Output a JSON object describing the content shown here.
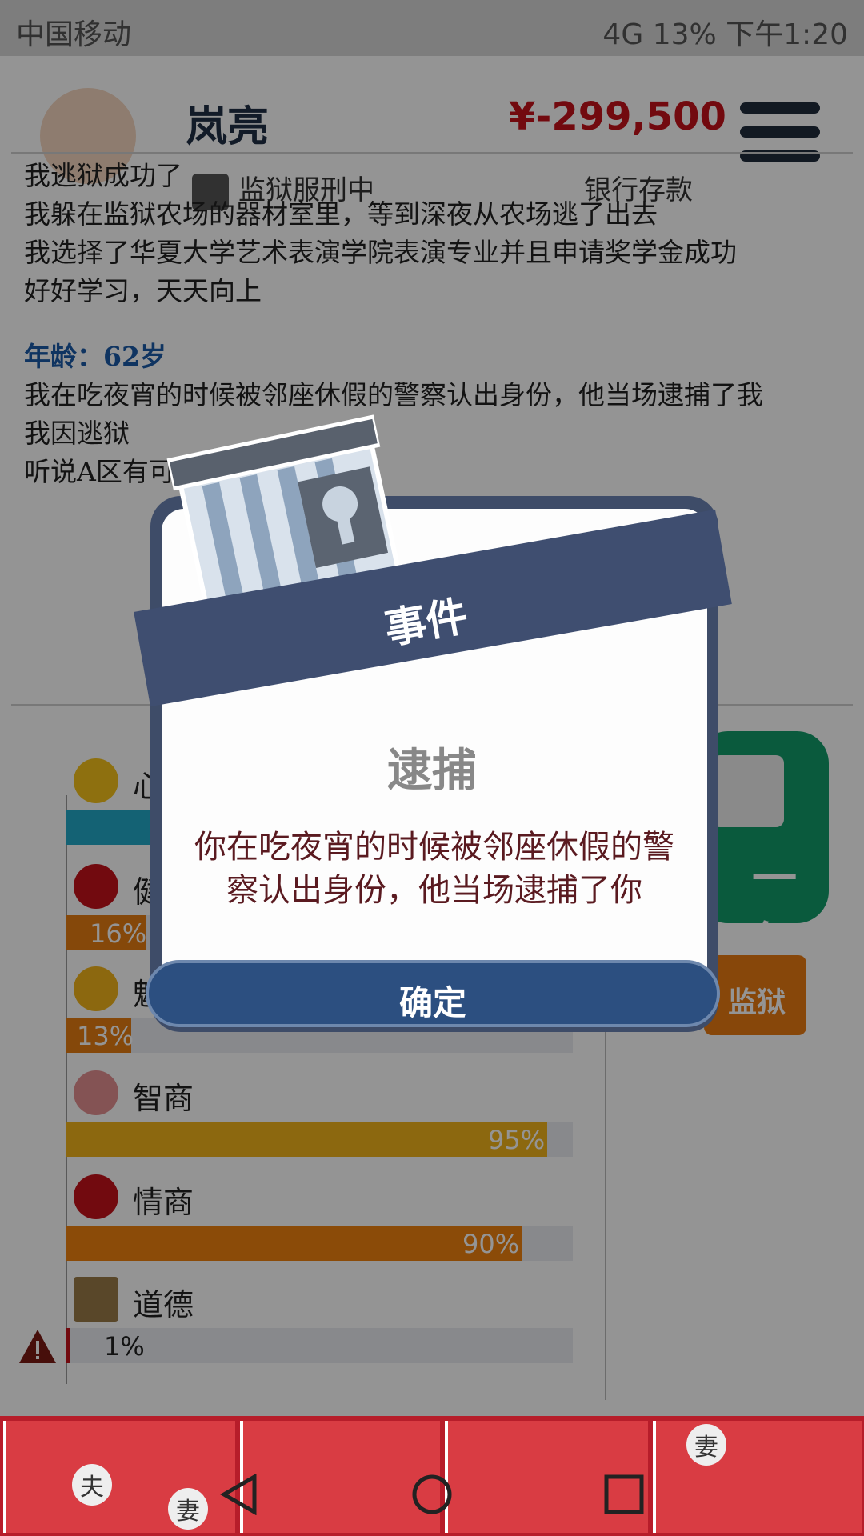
{
  "status_bar": {
    "carrier": "中国移动",
    "network": "4G",
    "battery": "13%",
    "time": "下午1:20"
  },
  "header": {
    "name": "岚亮",
    "money": "¥-299,500",
    "prison_status": "监狱服刑中",
    "bank_label": "银行存款"
  },
  "log": {
    "lines": [
      "我逃狱成功了",
      "我躲在监狱农场的器材室里，等到深夜从农场逃了出去",
      "我选择了华夏大学艺术表演学院表演专业并且申请奖学金成功",
      "好好学习，天天向上"
    ],
    "age": "年龄：62岁",
    "lines2": [
      "我在吃夜宵的时候被邻座休假的警察认出身份，他当场逮捕了我",
      "我因逃狱",
      "听说A区有可以去找他"
    ]
  },
  "stats": [
    {
      "label": "心情",
      "value": 100,
      "text": "",
      "color": "#23a9c9"
    },
    {
      "label": "健康",
      "value": 16,
      "text": "16%",
      "color": "#e57c12"
    },
    {
      "label": "魅力",
      "value": 13,
      "text": "13%",
      "color": "#e57c12"
    },
    {
      "label": "智商",
      "value": 95,
      "text": "95%",
      "color": "#f2b41a"
    },
    {
      "label": "情商",
      "value": 90,
      "text": "90%",
      "color": "#f0820f"
    },
    {
      "label": "道德",
      "value": 1,
      "text": "1%",
      "color": "#c4121a"
    }
  ],
  "buttons": {
    "next_year": "一年",
    "prison": "监狱"
  },
  "dialog": {
    "banner": "事件",
    "event_title": "逮捕",
    "event_desc": "你在吃夜宵的时候被邻座休假的警察认出身份，他当场逮捕了你",
    "confirm": "确定"
  },
  "ad": {
    "labels": [
      "夫",
      "妻",
      "妻"
    ]
  },
  "icons": [
    "smile-icon",
    "broken-heart-icon",
    "sun-cloud-icon",
    "brain-icon",
    "apple-icon",
    "scale-icon",
    "warning-icon",
    "menu-icon",
    "calendar-icon",
    "prison-building-icon",
    "back-icon",
    "home-icon",
    "recent-apps-icon"
  ]
}
